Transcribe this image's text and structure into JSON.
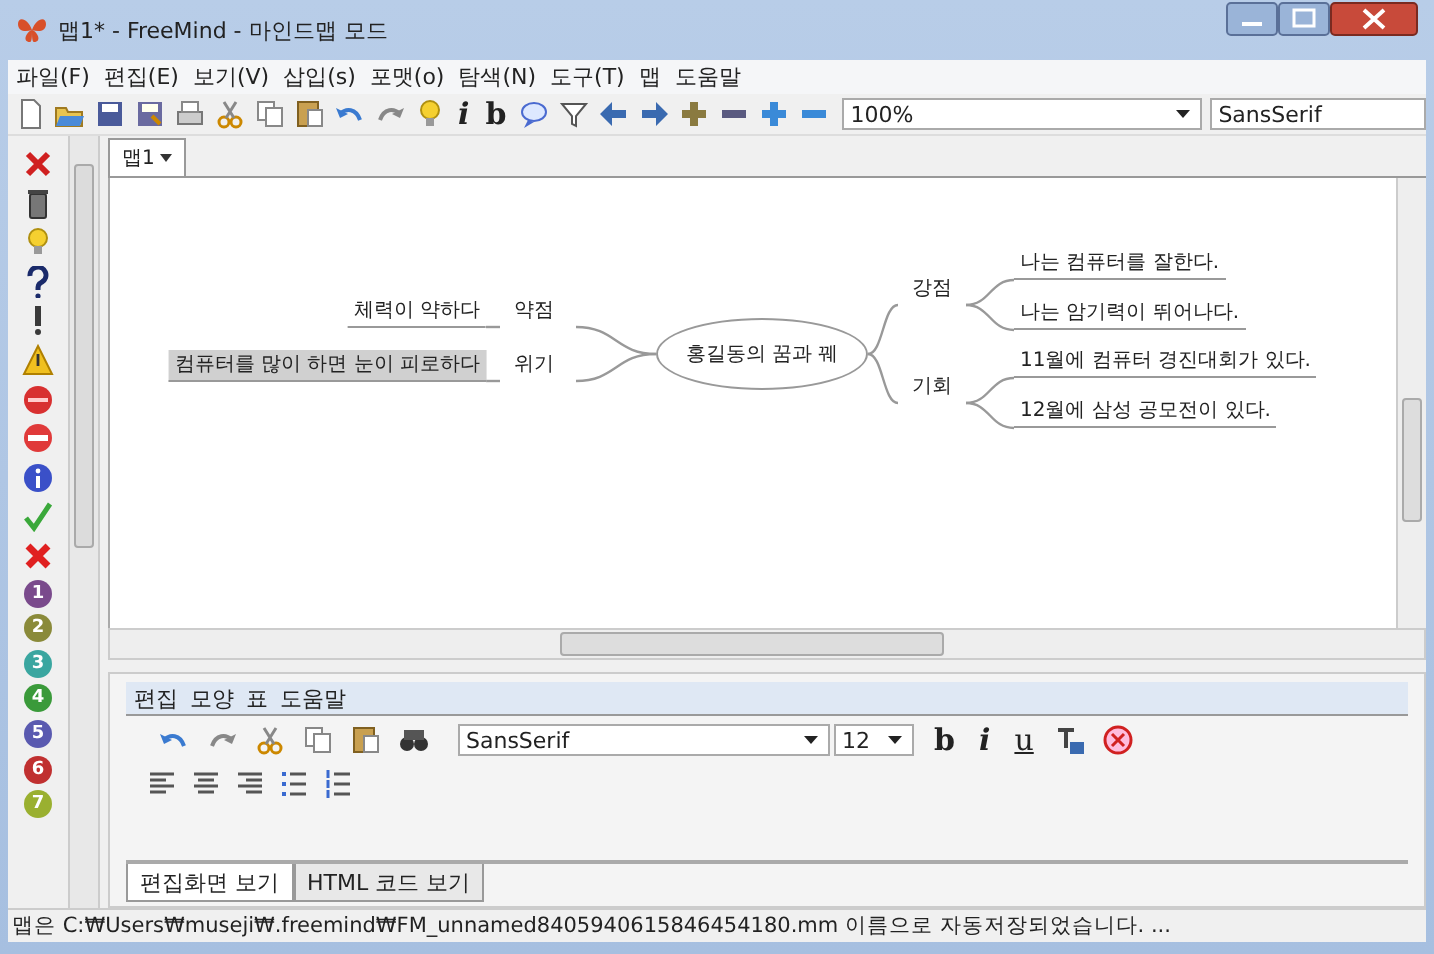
{
  "window": {
    "title": "맵1* - FreeMind - 마인드맵 모드"
  },
  "menu": [
    "파일(F)",
    "편집(E)",
    "보기(V)",
    "삽입(s)",
    "포맷(o)",
    "탐색(N)",
    "도구(T)",
    "맵",
    "도움말"
  ],
  "toolbar": {
    "items": [
      {
        "kind": "new"
      },
      {
        "kind": "open"
      },
      {
        "kind": "save"
      },
      {
        "kind": "save-as"
      },
      {
        "kind": "print"
      },
      {
        "kind": "cut"
      },
      {
        "kind": "copy"
      },
      {
        "kind": "paste"
      },
      {
        "kind": "undo"
      },
      {
        "kind": "redo"
      },
      {
        "kind": "bulb"
      },
      {
        "kind": "italic",
        "label": "i"
      },
      {
        "kind": "bold",
        "label": "b"
      },
      {
        "kind": "bubble"
      },
      {
        "kind": "filter"
      },
      {
        "kind": "left"
      },
      {
        "kind": "right"
      },
      {
        "kind": "plus"
      },
      {
        "kind": "minus"
      },
      {
        "kind": "plus-blue"
      },
      {
        "kind": "minus-blue"
      }
    ],
    "zoom": "100%",
    "font": "SansSerif"
  },
  "icon_bar": [
    {
      "kind": "remove"
    },
    {
      "kind": "trash"
    },
    {
      "kind": "bulb"
    },
    {
      "kind": "question"
    },
    {
      "kind": "exclamation"
    },
    {
      "kind": "warning"
    },
    {
      "kind": "stop"
    },
    {
      "kind": "no-entry"
    },
    {
      "kind": "info"
    },
    {
      "kind": "check"
    },
    {
      "kind": "cross"
    },
    {
      "kind": "number",
      "label": "1",
      "color": "#7a4a8c"
    },
    {
      "kind": "number",
      "label": "2",
      "color": "#8a8a3a"
    },
    {
      "kind": "number",
      "label": "3",
      "color": "#3aa6a0"
    },
    {
      "kind": "number",
      "label": "4",
      "color": "#3a9a3a"
    },
    {
      "kind": "number",
      "label": "5",
      "color": "#5a5ab0"
    },
    {
      "kind": "number",
      "label": "6",
      "color": "#c03030"
    },
    {
      "kind": "number",
      "label": "7",
      "color": "#9ab030"
    }
  ],
  "tabs": [
    {
      "label": "맵1",
      "selected": true
    }
  ],
  "mindmap": {
    "root": "홍길동의 꿈과 꿰",
    "left": [
      {
        "label": "약점",
        "children": [
          {
            "label": "체력이 약하다",
            "selected": false
          }
        ]
      },
      {
        "label": "위기",
        "children": [
          {
            "label": "컴퓨터를 많이 하면 눈이 피로하다",
            "selected": true
          }
        ]
      }
    ],
    "right": [
      {
        "label": "강점",
        "children": [
          {
            "label": "나는 컴퓨터를 잘한다.",
            "selected": false
          },
          {
            "label": "나는 암기력이 뛰어나다.",
            "selected": false
          }
        ]
      },
      {
        "label": "기회",
        "children": [
          {
            "label": "11월에 컴퓨터 경진대회가 있다.",
            "selected": false
          },
          {
            "label": "12월에 삼성 공모전이 있다.",
            "selected": false
          }
        ]
      }
    ]
  },
  "editor": {
    "menu": [
      "편집",
      "모양",
      "표",
      "도움말"
    ],
    "tools": [
      {
        "kind": "undo"
      },
      {
        "kind": "redo"
      },
      {
        "kind": "cut"
      },
      {
        "kind": "copy"
      },
      {
        "kind": "paste"
      },
      {
        "kind": "find"
      }
    ],
    "font": "SansSerif",
    "size": "12",
    "format": [
      {
        "kind": "bold",
        "label": "b"
      },
      {
        "kind": "italic",
        "label": "i"
      },
      {
        "kind": "underline",
        "label": "u"
      },
      {
        "kind": "text-color"
      },
      {
        "kind": "clear"
      }
    ],
    "align": [
      {
        "kind": "align-left"
      },
      {
        "kind": "align-center"
      },
      {
        "kind": "align-right"
      },
      {
        "kind": "bullets"
      },
      {
        "kind": "numbers"
      }
    ],
    "tabs": [
      {
        "label": "편집화면 보기",
        "selected": true
      },
      {
        "label": "HTML 코드 보기",
        "selected": false
      }
    ]
  },
  "status_bar": "맵은 C:₩Users₩museji₩.freemind₩FM_unnamed8405940615846454180.mm 이름으로 자동저장되었습니다. ..."
}
